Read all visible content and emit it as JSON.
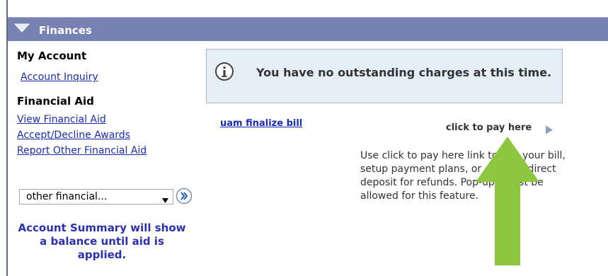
{
  "header": {
    "title": "Finances",
    "icon": "chevron-down-icon"
  },
  "sidebar": {
    "my_account_heading": "My Account",
    "account_inquiry": "Account Inquiry",
    "financial_aid_heading": "Financial Aid",
    "links": [
      "View Financial Aid",
      "Accept/Decline Awards",
      "Report Other Financial Aid"
    ],
    "select_value": "other financial...",
    "summary_note": "Account Summary will show a balance until aid is applied."
  },
  "main": {
    "info_message": "You have no outstanding charges at this time.",
    "finalize_link": "uam finalize bill",
    "pay_link": "click to pay here",
    "description": "Use click to pay here link to pay your bill, setup payment plans, or enroll in direct deposit for refunds. Pop-ups must be allowed for this feature."
  },
  "colors": {
    "header_bg": "#7781b2",
    "link": "#1a2bb6",
    "summary_text": "#2b2fb4",
    "info_bg": "#e5edf5",
    "arrow_overlay": "#8dc63f"
  }
}
